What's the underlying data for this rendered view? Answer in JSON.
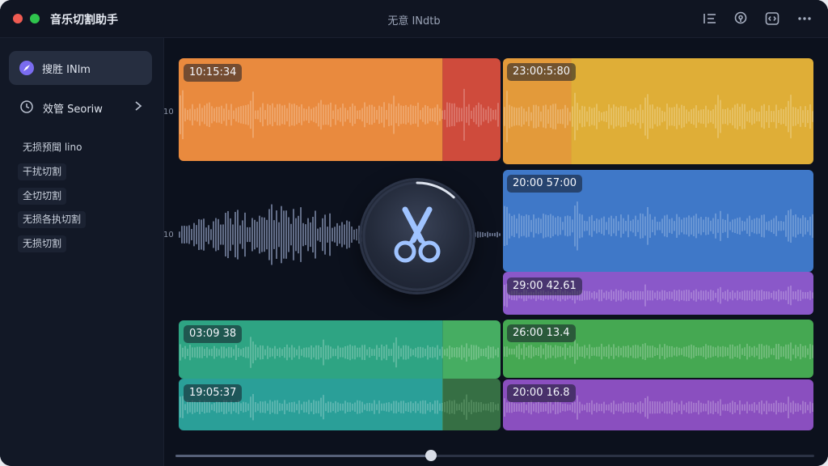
{
  "window": {
    "app_title": "音乐切割助手",
    "doc_title": "无意 INdtb"
  },
  "toolbar": {
    "icons": [
      "list-icon",
      "location-pin-icon",
      "code-icon",
      "more-icon"
    ]
  },
  "sidebar": {
    "active_item": {
      "label": "搜胜 INlm",
      "icon": "compass-icon"
    },
    "item2": {
      "label": "效管 Seoriw",
      "icon": "clock-icon"
    },
    "chips": [
      "无损预聞 lino",
      "干扰切割",
      "全切切割",
      "无损各执切割",
      "无损切割"
    ]
  },
  "editor": {
    "axis_labels": [
      "10",
      "10"
    ],
    "clips": [
      {
        "time": "10:15:34",
        "colors": [
          "#e98a3e",
          "#cf4b3c"
        ],
        "label_name": "clip-time-1"
      },
      {
        "time": "23:00:5:80",
        "colors": [
          "#e39a3a",
          "#dfae37"
        ],
        "label_name": "clip-time-2"
      },
      {
        "time": "20:00 57:00",
        "colors": [
          "#3f78c8"
        ],
        "label_name": "clip-time-3"
      },
      {
        "time": "29:00 42.61",
        "colors": [
          "#8a58c9"
        ],
        "label_name": "clip-time-4"
      },
      {
        "time": "03:09 38",
        "colors": [
          "#2ea483",
          "#46ad62"
        ],
        "label_name": "clip-time-5"
      },
      {
        "time": "19:05:37",
        "colors": [
          "#2a9f98"
        ],
        "label_name": "clip-time-6"
      },
      {
        "time": "26:00 13.4",
        "colors": [
          "#45a852"
        ],
        "label_name": "clip-time-7"
      },
      {
        "time": "20:00 16.8",
        "colors": [
          "#8a4fbf"
        ],
        "label_name": "clip-time-8"
      }
    ],
    "cut_button_icon": "scissors-icon",
    "cut_progress": 0.12,
    "playhead_fraction": 0.4
  }
}
